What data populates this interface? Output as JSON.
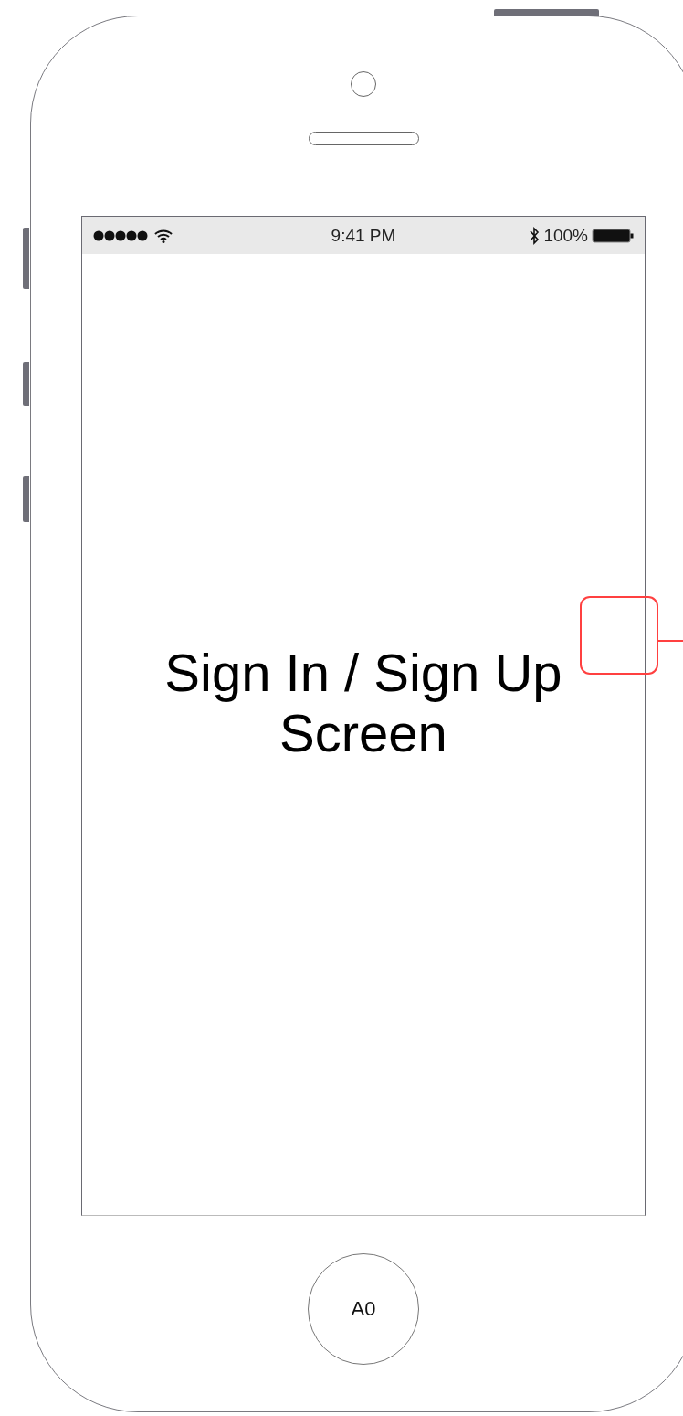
{
  "status_bar": {
    "time": "9:41 PM",
    "battery": "100%"
  },
  "screen": {
    "title": "Sign In / Sign Up Screen"
  },
  "home_button": {
    "label": "A0"
  }
}
